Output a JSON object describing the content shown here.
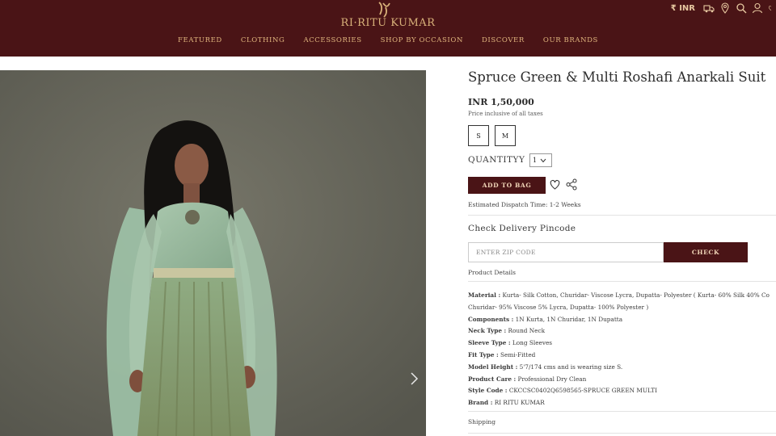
{
  "brand": {
    "name": "RI·RITU KUMAR"
  },
  "header": {
    "currency": "₹ INR",
    "nav": [
      "FEATURED",
      "CLOTHING",
      "ACCESSORIES",
      "SHOP BY OCCASION",
      "DISCOVER",
      "OUR BRANDS"
    ],
    "icons": [
      "currency-icon",
      "truck-icon",
      "location-pin-icon",
      "search-icon",
      "account-icon",
      "wishlist-icon"
    ]
  },
  "product": {
    "title": "Spruce Green & Multi Roshafi Anarkali Suit",
    "price": "INR 1,50,000",
    "tax_note": "Price inclusive of all taxes",
    "sizes": [
      "S",
      "M"
    ],
    "quantity_label": "QUANTITYY",
    "quantity_value": "1",
    "add_to_bag": "ADD TO BAG",
    "dispatch": "Estimated Dispatch Time: 1-2 Weeks",
    "pincode_title": "Check Delivery Pincode",
    "zip_placeholder": "ENTER ZIP CODE",
    "check_label": "CHECK",
    "details_title": "Product Details",
    "attributes": [
      {
        "label": "Material :",
        "value": " Kurta- Silk Cotton, Churidar- Viscose Lycra, Dupatta- Polyester ( Kurta- 60% Silk 40% Co"
      },
      {
        "label": "",
        "value": "Churidar- 95% Viscose 5% Lycra, Dupatta- 100% Polyester )"
      },
      {
        "label": "Components :",
        "value": " 1N Kurta, 1N Churidar, 1N Dupatta"
      },
      {
        "label": "Neck Type :",
        "value": " Round Neck"
      },
      {
        "label": "Sleeve Type :",
        "value": " Long Sleeves"
      },
      {
        "label": "Fit Type :",
        "value": " Semi-Fitted"
      },
      {
        "label": "Model Height :",
        "value": " 5'7/174 cms and is wearing size S."
      },
      {
        "label": "Product Care :",
        "value": " Professional Dry Clean"
      },
      {
        "label": "Style Code :",
        "value": " CKCCSC0402Q6598565-SPRUCE GREEN MULTI"
      },
      {
        "label": "Brand :",
        "value": " RI RITU KUMAR"
      }
    ],
    "shipping": "Shipping"
  },
  "colors": {
    "maroon": "#4a1416",
    "gold": "#e0b57e",
    "backdrop": "#66665c",
    "dress": "#9cbaa0"
  }
}
